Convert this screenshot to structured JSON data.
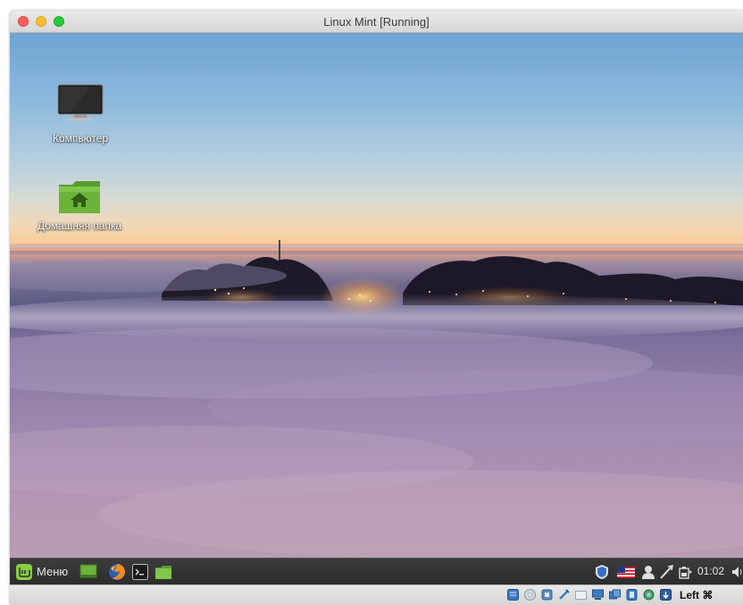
{
  "window": {
    "title": "Linux Mint [Running]"
  },
  "desktop": {
    "icons": [
      {
        "label": "Компьютер",
        "icon": "monitor-icon"
      },
      {
        "label": "Домашняя папка",
        "icon": "home-folder-icon"
      }
    ]
  },
  "panel": {
    "menu_label": "Меню",
    "launchers": [
      "show-desktop-icon",
      "firefox-icon",
      "terminal-icon",
      "files-icon"
    ],
    "tray": [
      "shield-icon",
      "us-flag-icon",
      "user-icon",
      "network-icon",
      "battery-icon",
      "volume-icon"
    ],
    "clock": "01:02"
  },
  "vm_statusbar": {
    "icons": [
      "hdd-icon",
      "optical-drive-icon",
      "audio-icon",
      "usb-icon",
      "shared-folders-icon",
      "display-icon",
      "network-adapter-icon",
      "recording-icon",
      "cpu-icon",
      "mouse-integration-icon"
    ],
    "host_key": "Left ⌘"
  },
  "colors": {
    "panel_bg": "#2f2f2f",
    "mint_green": "#87cf3e",
    "folder_green": "#6cb33a",
    "statusbar_bg": "#dcdcdc"
  }
}
